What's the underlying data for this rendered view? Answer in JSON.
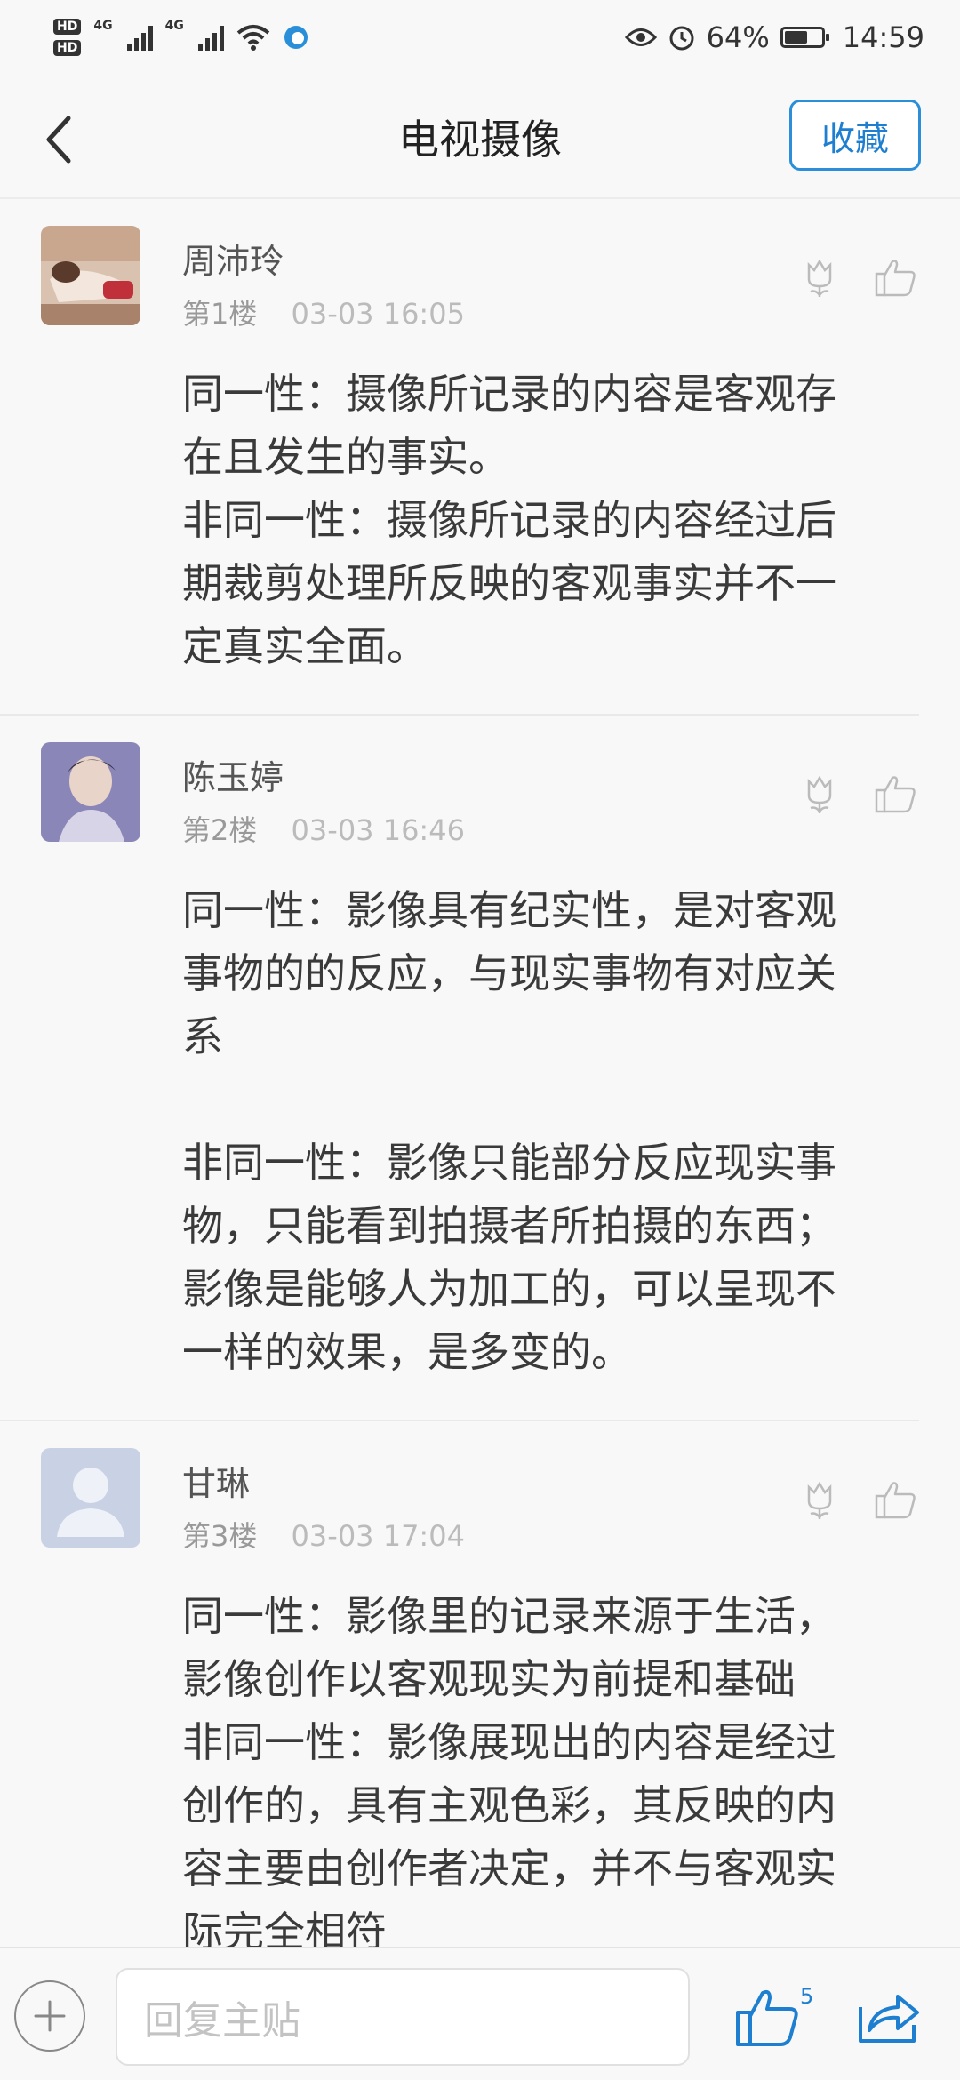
{
  "status_bar": {
    "hd1": "HD",
    "hd2": "HD",
    "net1": "4G",
    "net2": "4G",
    "battery": "64%",
    "battery_level": 0.64,
    "time": "14:59",
    "icons": [
      "eye-comfort-icon",
      "alarm-icon",
      "wifi-icon",
      "signal-icon"
    ]
  },
  "nav": {
    "title": "电视摄像",
    "favorite_label": "收藏"
  },
  "posts": [
    {
      "user": "周沛玲",
      "floor": "第1楼",
      "time": "03-03 16:05",
      "content": "同一性：摄像所记录的内容是客观存在且发生的事实。\n非同一性：摄像所记录的内容经过后期裁剪处理所反映的客观事实并不一定真实全面。"
    },
    {
      "user": "陈玉婷",
      "floor": "第2楼",
      "time": "03-03 16:46",
      "content": "同一性：影像具有纪实性，是对客观事物的的反应，与现实事物有对应关系\n\n非同一性：影像只能部分反应现实事物，只能看到拍摄者所拍摄的东西；影像是能够人为加工的，可以呈现不一样的效果，是多变的。"
    },
    {
      "user": "甘琳",
      "floor": "第3楼",
      "time": "03-03 17:04",
      "content": "同一性：影像里的记录来源于生活，影像创作以客观现实为前提和基础\n非同一性：影像展现出的内容是经过创作的，具有主观色彩，其反映的内容主要由创作者决定，并不与客观实际完全相符"
    }
  ],
  "bottom_bar": {
    "reply_placeholder": "回复主贴",
    "like_count": "5"
  },
  "colors": {
    "accent": "#1e7fd0",
    "text": "#3a3a3a",
    "muted": "#aaaaaa"
  }
}
